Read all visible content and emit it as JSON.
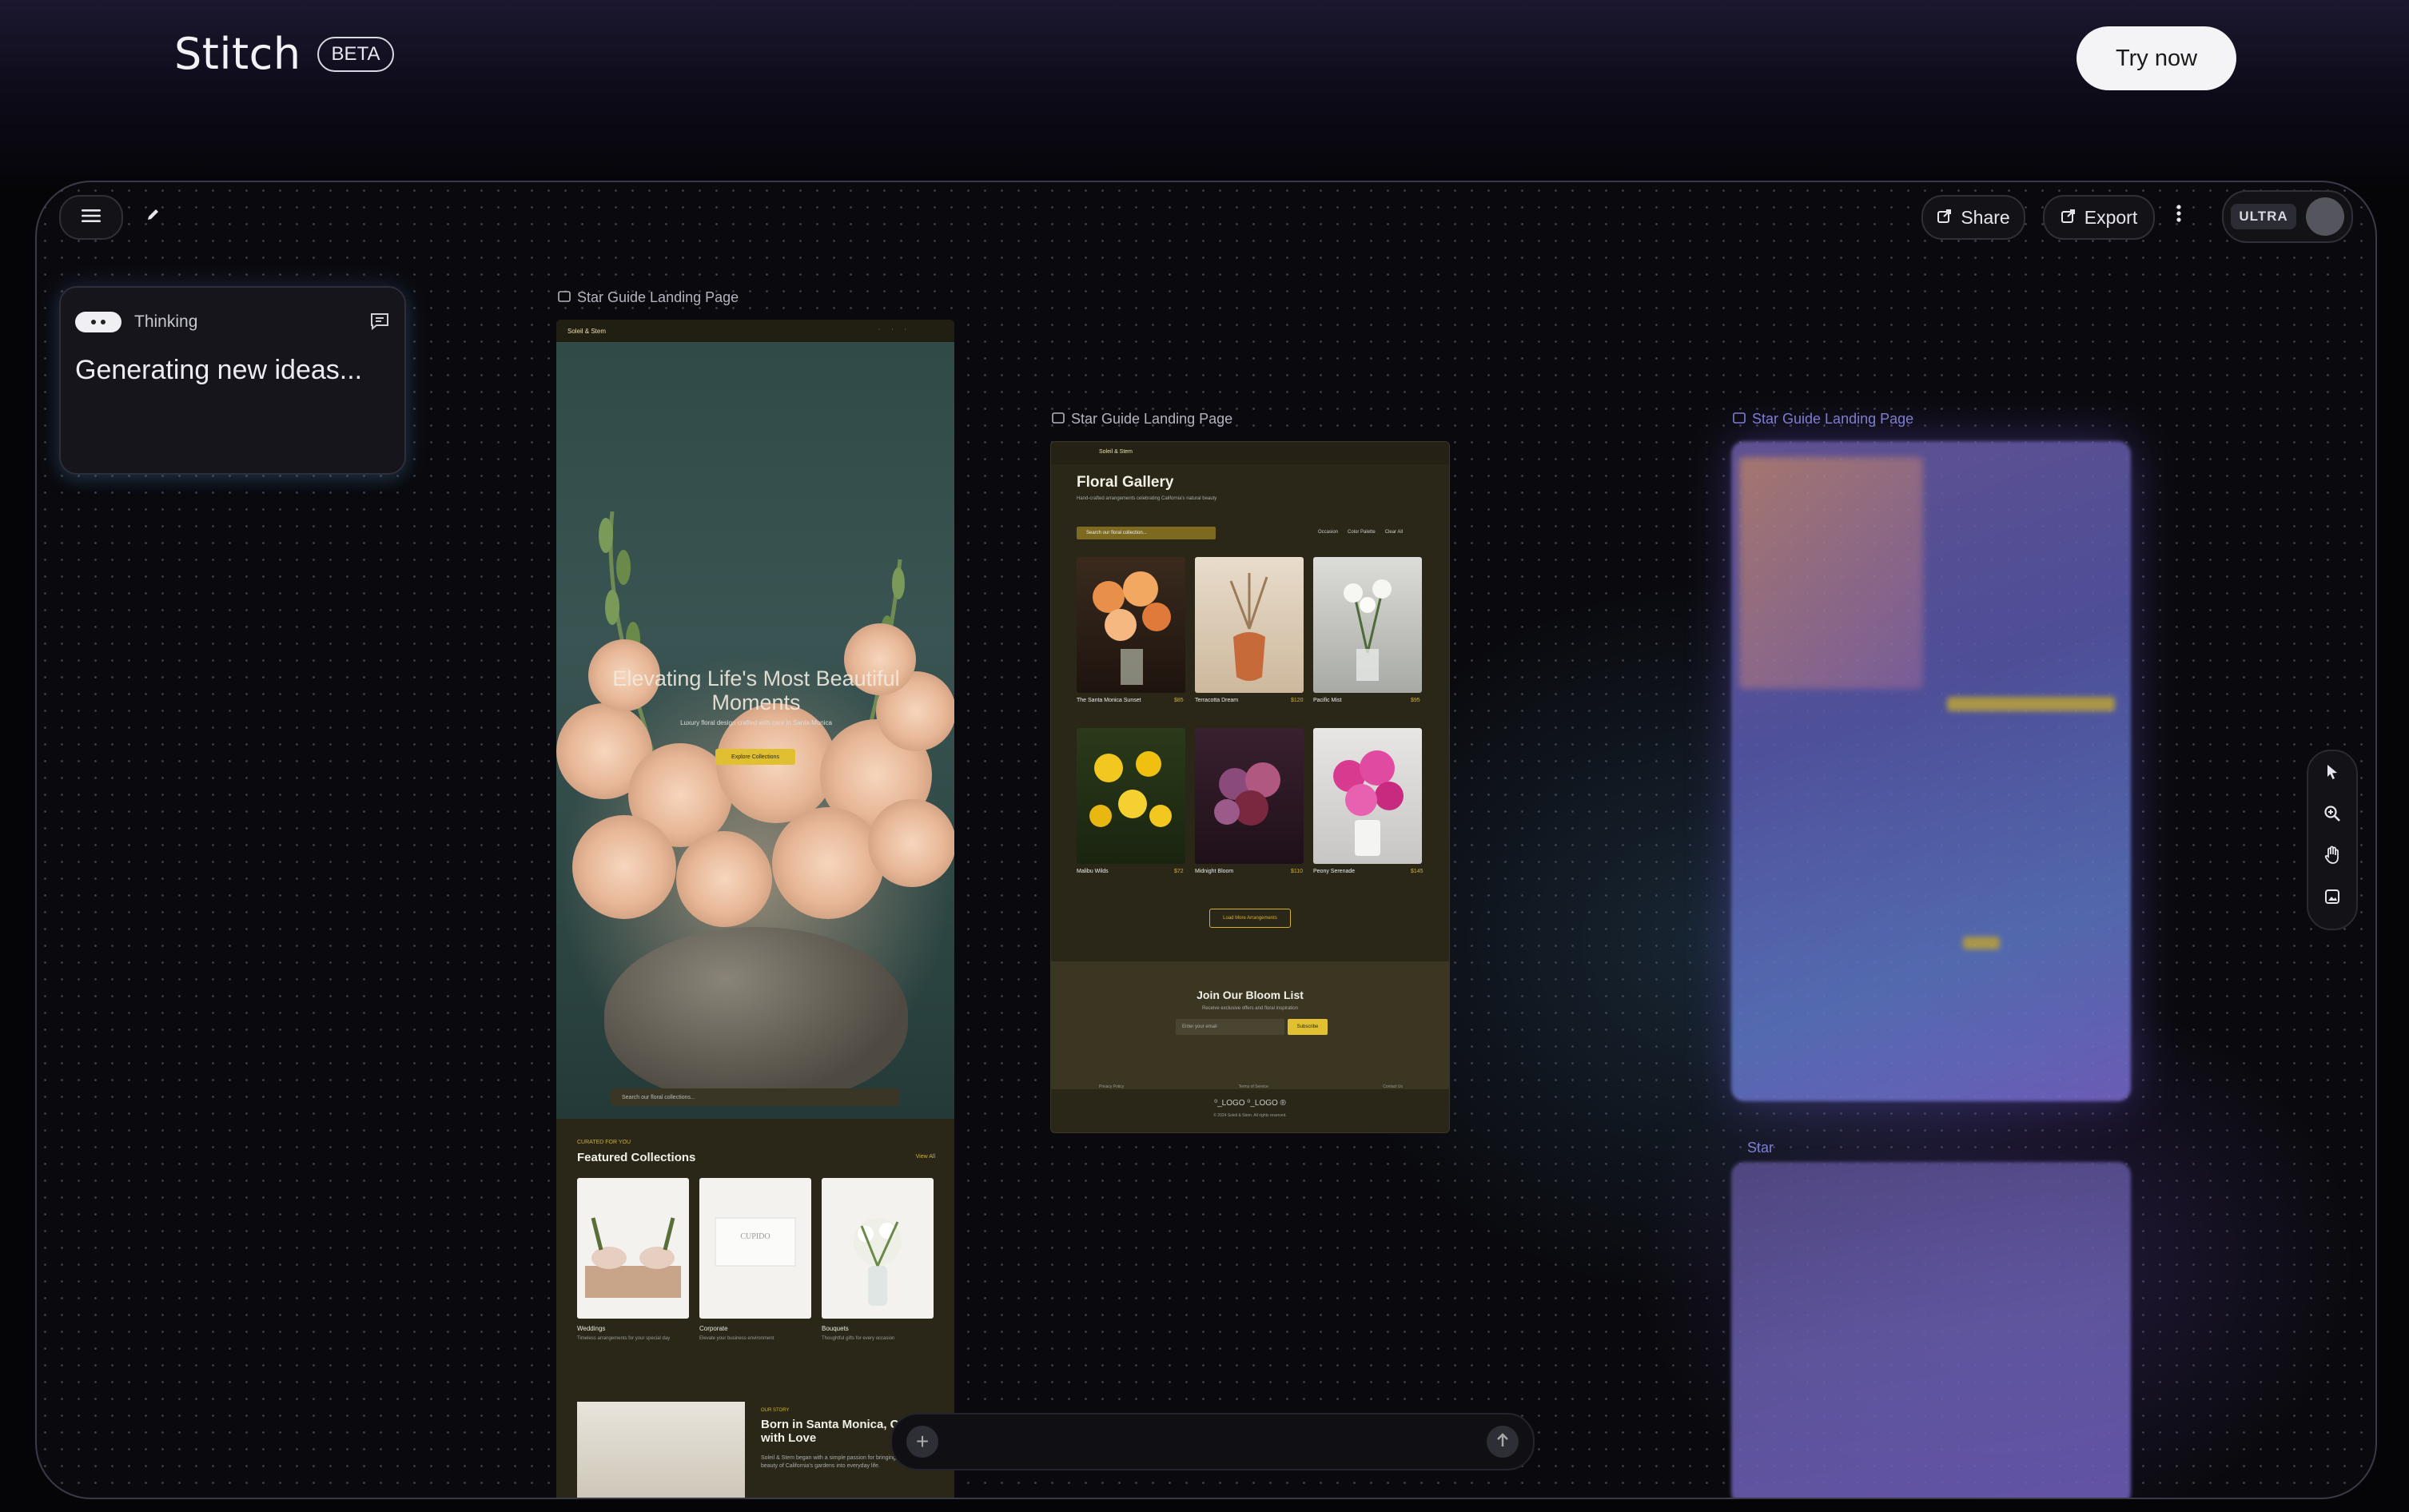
{
  "header": {
    "brand": "Stitch",
    "badge": "BETA",
    "cta": "Try now"
  },
  "toolbar": {
    "share": "Share",
    "export": "Export",
    "plan": "ULTRA"
  },
  "thinking": {
    "label": "Thinking",
    "message": "Generating new ideas..."
  },
  "screens": {
    "s1_label": "Star Guide Landing Page",
    "s2_label": "Star Guide Landing Page",
    "s3_label": "Star Guide Landing Page",
    "s4_label": "Star",
    "s1": {
      "logo": "Soleil & Stem",
      "hero_title": "Elevating Life's Most Beautiful Moments",
      "hero_sub": "Luxury floral design crafted with care in Santa Monica",
      "hero_cta": "Explore Collections",
      "search_placeholder": "Search our floral collections...",
      "featured_eyebrow": "CURATED FOR YOU",
      "featured_title": "Featured Collections",
      "view_all": "View All",
      "collections": [
        {
          "name": "Weddings",
          "desc": "Timeless arrangements for your special day"
        },
        {
          "name": "Corporate",
          "desc": "Elevate your business environment"
        },
        {
          "name": "Bouquets",
          "desc": "Thoughtful gifts for every occasion"
        }
      ],
      "story_eyebrow": "OUR STORY",
      "story_title": "Born in Santa Monica, Crafted with Love",
      "story_text": "Soleil & Stem began with a simple passion for bringing the beauty of California's gardens into everyday life."
    },
    "s2": {
      "logo": "Soleil & Stem",
      "title": "Floral Gallery",
      "subtitle": "Hand-crafted arrangements celebrating California's natural beauty",
      "search_placeholder": "Search our floral collection...",
      "filters": [
        "Occasion",
        "Color Palette",
        "Clear All"
      ],
      "products": [
        {
          "name": "The Santa Monica Sunset",
          "price": "$85"
        },
        {
          "name": "Terracotta Dream",
          "price": "$120"
        },
        {
          "name": "Pacific Mist",
          "price": "$95"
        },
        {
          "name": "Malibu Wilds",
          "price": "$72"
        },
        {
          "name": "Midnight Bloom",
          "price": "$110"
        },
        {
          "name": "Peony Serenade",
          "price": "$145"
        }
      ],
      "explore": "Load More Arrangements",
      "join_title": "Join Our Bloom List",
      "join_sub": "Receive exclusive offers and floral inspiration",
      "email_placeholder": "Enter your email",
      "subscribe": "Subscribe",
      "footer_links": [
        "Privacy Policy",
        "Terms of Service",
        "Contact Us"
      ],
      "footer_logos": "⁰_LOGO ⁰_LOGO ®",
      "copyright": "© 2024 Soleil & Stem. All rights reserved."
    }
  },
  "prompt": {
    "plus": "+"
  },
  "colors": {
    "accent": "#e0c030",
    "background": "#0a0a0e",
    "cta_bg": "#f4f4f6"
  }
}
